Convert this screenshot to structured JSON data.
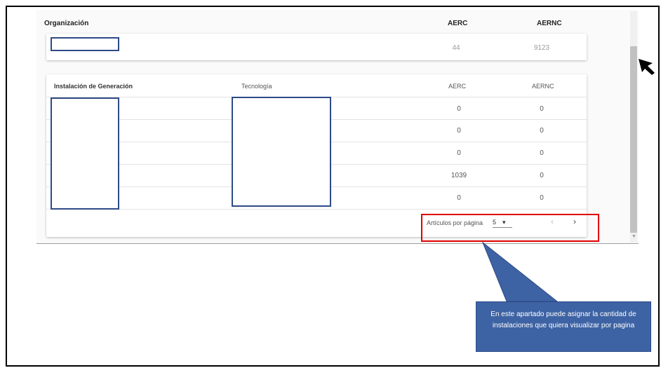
{
  "org_section": {
    "col_org": "Organización",
    "col_aerc": "AERC",
    "col_aernc": "AERNC",
    "row": {
      "aerc": "44",
      "aernc": "9123"
    }
  },
  "table": {
    "headers": {
      "installation": "Instalación de Generación",
      "sort_icon": "↑",
      "technology": "Tecnología",
      "aerc": "AERC",
      "aernc": "AERNC"
    },
    "rows": [
      {
        "aerc": "0",
        "aernc": "0"
      },
      {
        "aerc": "0",
        "aernc": "0"
      },
      {
        "aerc": "0",
        "aernc": "0"
      },
      {
        "aerc": "1039",
        "aernc": "0"
      },
      {
        "aerc": "0",
        "aernc": "0"
      }
    ]
  },
  "pagination": {
    "items_per_page_label": "Artículos por página",
    "items_per_page_value": "5",
    "dropdown_icon": "▾",
    "prev_icon": "‹",
    "next_icon": "›"
  },
  "callout": {
    "text": "En este apartado puede asignar la cantidad de instalaciones que quiera visualizar por pagina"
  },
  "colors": {
    "highlight": "#e00000",
    "redaction": "#2e4a86",
    "callout_fill": "#3e63a4"
  }
}
